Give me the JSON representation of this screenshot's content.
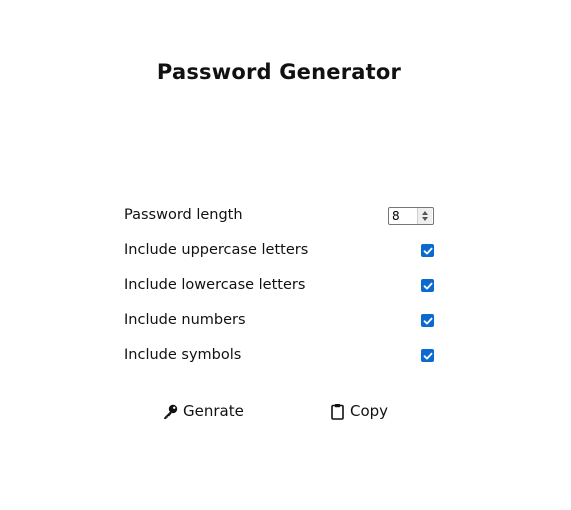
{
  "app": {
    "title": "Password Generator"
  },
  "options": {
    "length": {
      "label": "Password length",
      "value": "8"
    },
    "uppercase": {
      "label": "Include uppercase letters",
      "checked": true
    },
    "lowercase": {
      "label": "Include lowercase letters",
      "checked": true
    },
    "numbers": {
      "label": "Include numbers",
      "checked": true
    },
    "symbols": {
      "label": "Include symbols",
      "checked": true
    }
  },
  "actions": {
    "generate": {
      "label": "Genrate",
      "icon": "key-icon"
    },
    "copy": {
      "label": "Copy",
      "icon": "clipboard-icon"
    }
  },
  "colors": {
    "accent": "#0b6ad0",
    "text": "#111111",
    "background": "#ffffff"
  }
}
